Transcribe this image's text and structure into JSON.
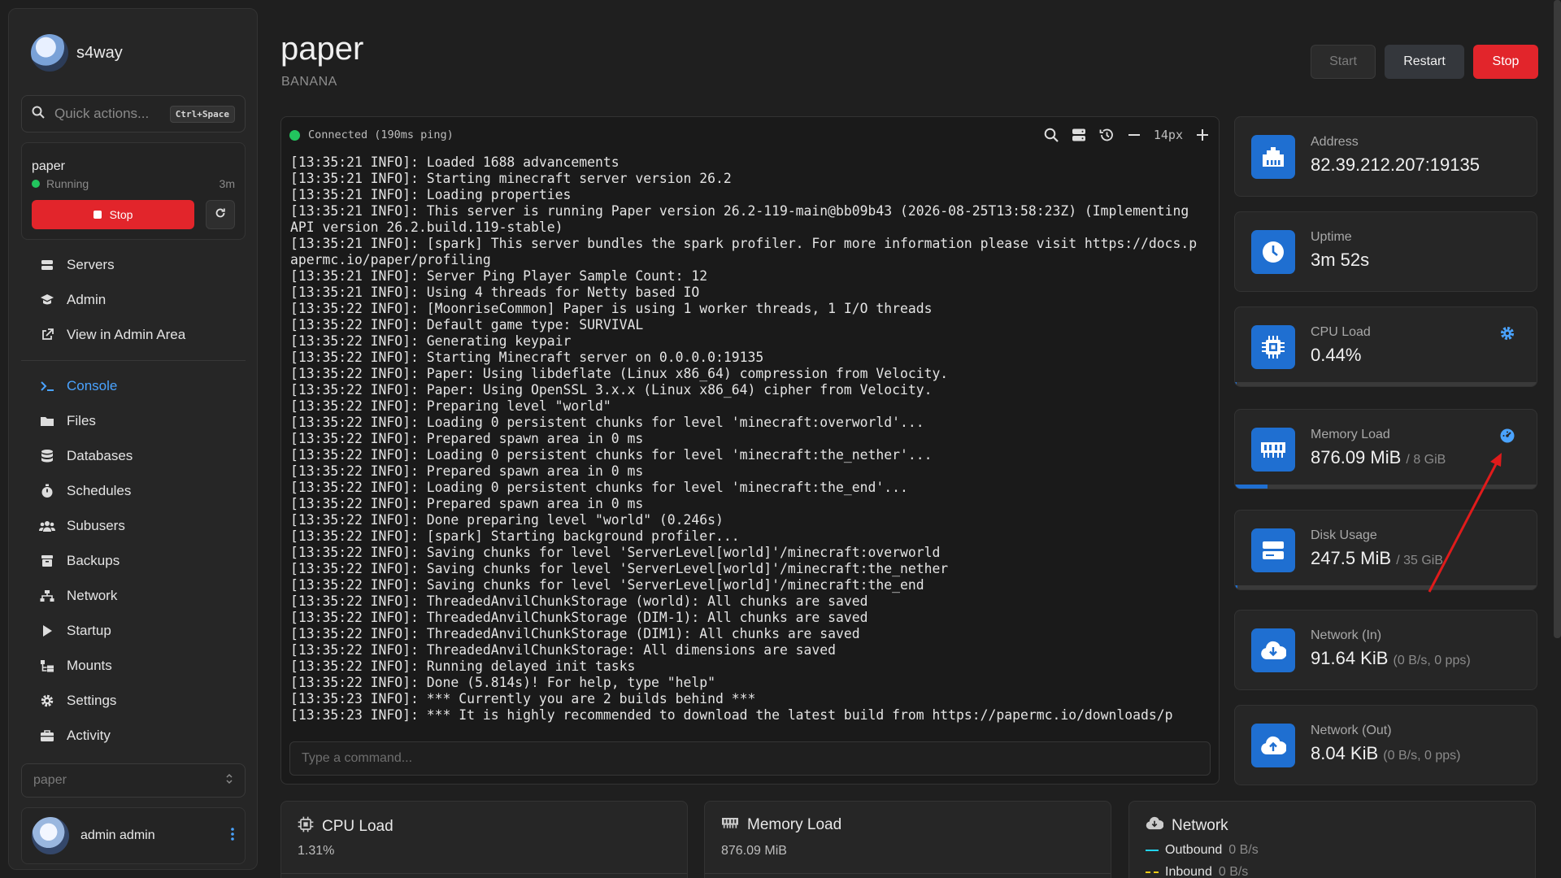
{
  "brand": {
    "name": "s4way"
  },
  "quick_actions": {
    "placeholder": "Quick actions...",
    "shortcut": "Ctrl+Space"
  },
  "server_card": {
    "name": "paper",
    "status": "Running",
    "uptime": "3m",
    "stop_label": "Stop"
  },
  "nav_top": [
    {
      "label": "Servers",
      "icon": "server-icon"
    },
    {
      "label": "Admin",
      "icon": "admin-icon"
    },
    {
      "label": "View in Admin Area",
      "icon": "external-link-icon"
    }
  ],
  "nav_main": [
    {
      "label": "Console",
      "icon": "terminal-icon",
      "active": true
    },
    {
      "label": "Files",
      "icon": "folder-icon"
    },
    {
      "label": "Databases",
      "icon": "database-icon"
    },
    {
      "label": "Schedules",
      "icon": "stopwatch-icon"
    },
    {
      "label": "Subusers",
      "icon": "users-icon"
    },
    {
      "label": "Backups",
      "icon": "archive-icon"
    },
    {
      "label": "Network",
      "icon": "network-icon"
    },
    {
      "label": "Startup",
      "icon": "play-icon"
    },
    {
      "label": "Mounts",
      "icon": "mount-icon"
    },
    {
      "label": "Settings",
      "icon": "gear-icon"
    },
    {
      "label": "Activity",
      "icon": "briefcase-icon"
    }
  ],
  "server_select": {
    "value": "paper"
  },
  "user": {
    "name": "admin admin"
  },
  "header": {
    "title": "paper",
    "subtitle": "BANANA",
    "start_label": "Start",
    "restart_label": "Restart",
    "stop_label": "Stop"
  },
  "console": {
    "status": "Connected (190ms ping)",
    "font_size": "14px",
    "input_placeholder": "Type a command...",
    "lines": [
      "[13:35:21 INFO]: Loaded 1688 advancements",
      "[13:35:21 INFO]: Starting minecraft server version 26.2",
      "[13:35:21 INFO]: Loading properties",
      "[13:35:21 INFO]: This server is running Paper version 26.2-119-main@bb09b43 (2026-08-25T13:58:23Z) (Implementing API version 26.2.build.119-stable)",
      "[13:35:21 INFO]: [spark] This server bundles the spark profiler. For more information please visit https://docs.papermc.io/paper/profiling",
      "[13:35:21 INFO]: Server Ping Player Sample Count: 12",
      "[13:35:21 INFO]: Using 4 threads for Netty based IO",
      "[13:35:22 INFO]: [MoonriseCommon] Paper is using 1 worker threads, 1 I/O threads",
      "[13:35:22 INFO]: Default game type: SURVIVAL",
      "[13:35:22 INFO]: Generating keypair",
      "[13:35:22 INFO]: Starting Minecraft server on 0.0.0.0:19135",
      "[13:35:22 INFO]: Paper: Using libdeflate (Linux x86_64) compression from Velocity.",
      "[13:35:22 INFO]: Paper: Using OpenSSL 3.x.x (Linux x86_64) cipher from Velocity.",
      "[13:35:22 INFO]: Preparing level \"world\"",
      "[13:35:22 INFO]: Loading 0 persistent chunks for level 'minecraft:overworld'...",
      "[13:35:22 INFO]: Prepared spawn area in 0 ms",
      "[13:35:22 INFO]: Loading 0 persistent chunks for level 'minecraft:the_nether'...",
      "[13:35:22 INFO]: Prepared spawn area in 0 ms",
      "[13:35:22 INFO]: Loading 0 persistent chunks for level 'minecraft:the_end'...",
      "[13:35:22 INFO]: Prepared spawn area in 0 ms",
      "[13:35:22 INFO]: Done preparing level \"world\" (0.246s)",
      "[13:35:22 INFO]: [spark] Starting background profiler...",
      "[13:35:22 INFO]: Saving chunks for level 'ServerLevel[world]'/minecraft:overworld",
      "[13:35:22 INFO]: Saving chunks for level 'ServerLevel[world]'/minecraft:the_nether",
      "[13:35:22 INFO]: Saving chunks for level 'ServerLevel[world]'/minecraft:the_end",
      "[13:35:22 INFO]: ThreadedAnvilChunkStorage (world): All chunks are saved",
      "[13:35:22 INFO]: ThreadedAnvilChunkStorage (DIM-1): All chunks are saved",
      "[13:35:22 INFO]: ThreadedAnvilChunkStorage (DIM1): All chunks are saved",
      "[13:35:22 INFO]: ThreadedAnvilChunkStorage: All dimensions are saved",
      "[13:35:22 INFO]: Running delayed init tasks",
      "[13:35:22 INFO]: Done (5.814s)! For help, type \"help\"",
      "[13:35:23 INFO]: *** Currently you are 2 builds behind ***",
      "[13:35:23 INFO]: *** It is highly recommended to download the latest build from https://papermc.io/downloads/p"
    ]
  },
  "stats": {
    "address": {
      "label": "Address",
      "value": "82.39.212.207:19135"
    },
    "uptime": {
      "label": "Uptime",
      "value": "3m 52s"
    },
    "cpu": {
      "label": "CPU Load",
      "value": "0.44%",
      "fraction": 0.0044
    },
    "memory": {
      "label": "Memory Load",
      "value": "876.09 MiB",
      "limit": "/ 8 GiB",
      "fraction": 0.107
    },
    "disk": {
      "label": "Disk Usage",
      "value": "247.5 MiB",
      "limit": "/ 35 GiB",
      "fraction": 0.007
    },
    "net_in": {
      "label": "Network (In)",
      "value": "91.64 KiB",
      "rate": "(0 B/s, 0 pps)"
    },
    "net_out": {
      "label": "Network (Out)",
      "value": "8.04 KiB",
      "rate": "(0 B/s, 0 pps)"
    }
  },
  "graphs": {
    "cpu": {
      "title": "CPU Load",
      "value": "1.31%"
    },
    "memory": {
      "title": "Memory Load",
      "value": "876.09 MiB"
    },
    "network": {
      "title": "Network",
      "outbound_label": "Outbound",
      "outbound_value": "0 B/s",
      "inbound_label": "Inbound",
      "inbound_value": "0 B/s",
      "outbound_color": "#22d3ee",
      "inbound_color": "#facc15"
    }
  },
  "colors": {
    "accent": "#1f6fd1",
    "danger": "#e2252b",
    "running": "#22c55e",
    "active_nav": "#4aa3ff",
    "annotation": "#e01b1b"
  }
}
